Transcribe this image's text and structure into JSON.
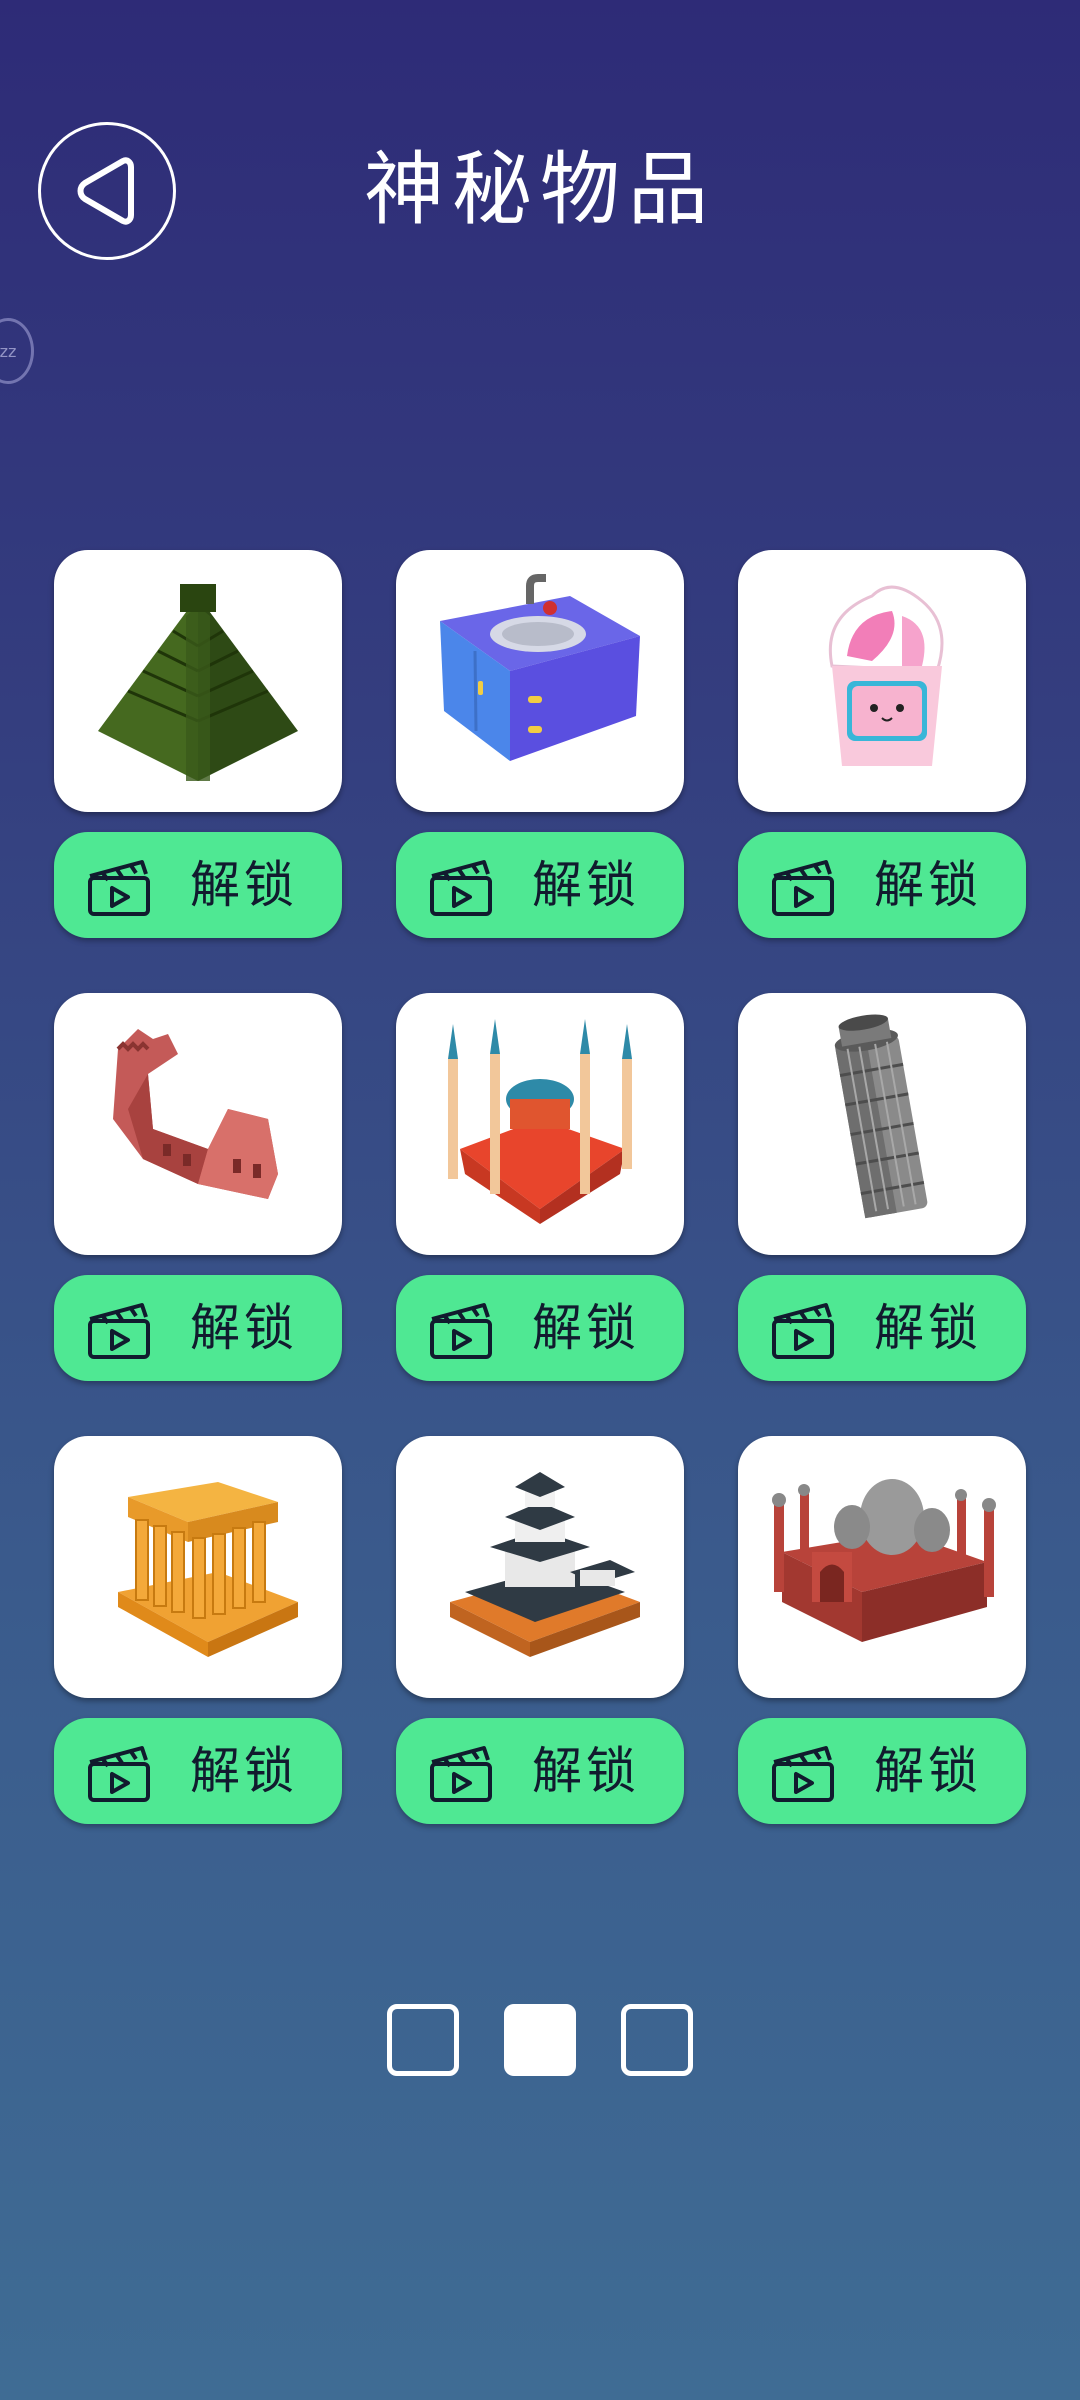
{
  "header": {
    "title": "神秘物品",
    "back_icon": "back-triangle-icon",
    "sleep_icon_text": "zz"
  },
  "items": [
    {
      "name": "chichen-itza-pyramid",
      "button_label": "解锁",
      "button_icon": "clapperboard-icon"
    },
    {
      "name": "sink-cabinet",
      "button_label": "解锁",
      "button_icon": "clapperboard-icon"
    },
    {
      "name": "ice-cream-cup",
      "button_label": "解锁",
      "button_icon": "clapperboard-icon"
    },
    {
      "name": "great-wall",
      "button_label": "解锁",
      "button_icon": "clapperboard-icon"
    },
    {
      "name": "hagia-sophia",
      "button_label": "解锁",
      "button_icon": "clapperboard-icon"
    },
    {
      "name": "leaning-tower-of-pisa",
      "button_label": "解锁",
      "button_icon": "clapperboard-icon"
    },
    {
      "name": "greek-temple",
      "button_label": "解锁",
      "button_icon": "clapperboard-icon"
    },
    {
      "name": "japanese-castle",
      "button_label": "解锁",
      "button_icon": "clapperboard-icon"
    },
    {
      "name": "red-mosque",
      "button_label": "解锁",
      "button_icon": "clapperboard-icon"
    }
  ],
  "pagination": {
    "total_pages": 3,
    "current_page": 2
  },
  "colors": {
    "background_top": "#2e2b77",
    "background_bottom": "#3f6c94",
    "unlock_button": "#4fe893",
    "card": "#ffffff"
  }
}
